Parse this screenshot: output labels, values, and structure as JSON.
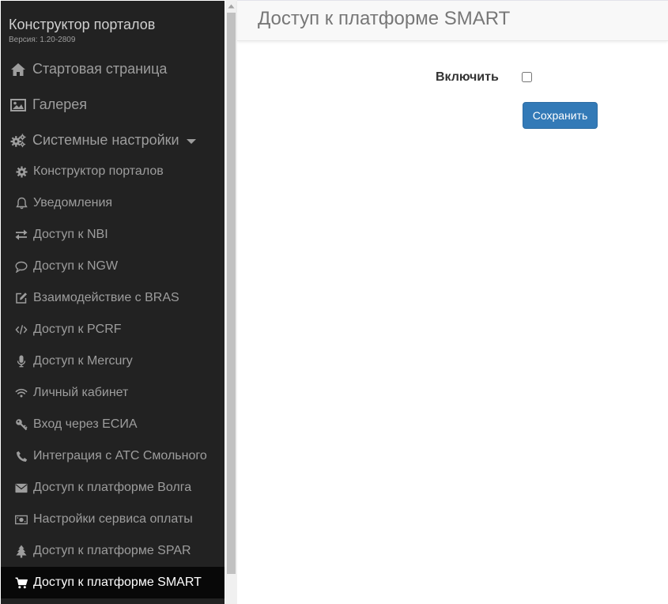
{
  "sidebar": {
    "brand_title": "Конструктор порталов",
    "version": "Версия: 1.20-2809",
    "top_items": [
      {
        "label": "Стартовая страница",
        "icon": "home-icon"
      },
      {
        "label": "Галерея",
        "icon": "image-icon"
      },
      {
        "label": "Системные настройки",
        "icon": "cogs-icon"
      }
    ],
    "sub_items": [
      {
        "label": "Конструктор порталов",
        "icon": "gear-icon"
      },
      {
        "label": "Уведомления",
        "icon": "bell-icon"
      },
      {
        "label": "Доступ к NBI",
        "icon": "transfer-icon"
      },
      {
        "label": "Доступ к NGW",
        "icon": "comment-icon"
      },
      {
        "label": "Взаимодействие с BRAS",
        "icon": "edit-icon"
      },
      {
        "label": "Доступ к PCRF",
        "icon": "code-icon"
      },
      {
        "label": "Доступ к Mercury",
        "icon": "microphone-icon"
      },
      {
        "label": "Личный кабинет",
        "icon": "wifi-icon"
      },
      {
        "label": "Вход через ЕСИА",
        "icon": "key-icon"
      },
      {
        "label": "Интеграция с АТС Смольного",
        "icon": "phone-icon"
      },
      {
        "label": "Доступ к платформе Волга",
        "icon": "envelope-icon"
      },
      {
        "label": "Настройки сервиса оплаты",
        "icon": "money-icon"
      },
      {
        "label": "Доступ к платформе SPAR",
        "icon": "tree-icon"
      },
      {
        "label": "Доступ к платформе SMART",
        "icon": "cart-icon",
        "active": true
      }
    ]
  },
  "main": {
    "title": "Доступ к платформе SMART",
    "enable_label": "Включить",
    "enable_checked": false,
    "save_label": "Сохранить"
  },
  "colors": {
    "sidebar_bg": "#222222",
    "sidebar_text": "#9d9d9d",
    "active_bg": "#080808",
    "primary_button": "#337ab7"
  }
}
